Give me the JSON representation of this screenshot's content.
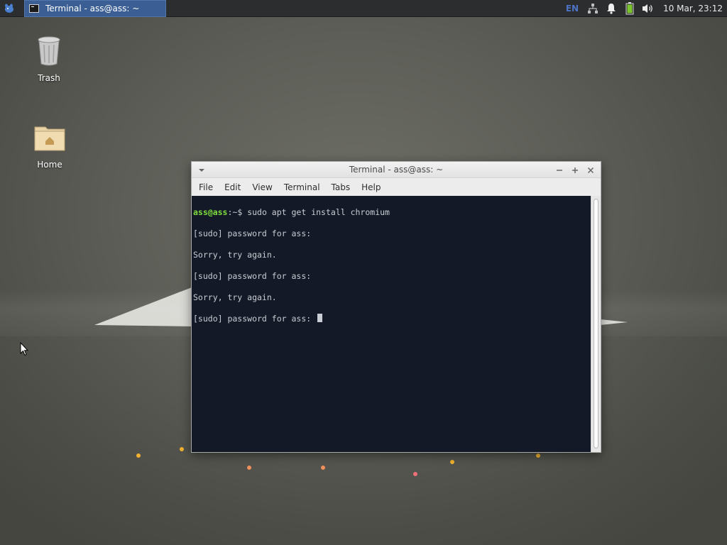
{
  "panel": {
    "app_menu_icon": "xfce-mouse-icon",
    "task_button": {
      "label": "Terminal - ass@ass: ~",
      "icon": "terminal-icon"
    },
    "tray": {
      "keyboard_layout": "EN",
      "network_icon": "network-icon",
      "notifications_icon": "bell-icon",
      "battery_icon": "battery-icon",
      "volume_icon": "speaker-icon",
      "clock": "10 Mar, 23:12"
    }
  },
  "desktop": {
    "icons": [
      {
        "label": "Trash",
        "icon": "trash-icon"
      },
      {
        "label": "Home",
        "icon": "home-folder-icon"
      }
    ]
  },
  "terminal": {
    "title": "Terminal - ass@ass: ~",
    "menus": [
      "File",
      "Edit",
      "View",
      "Terminal",
      "Tabs",
      "Help"
    ],
    "prompt": {
      "user_host": "ass@ass",
      "path": ":~",
      "symbol": "$",
      "command": " sudo apt get install chromium"
    },
    "output": [
      "[sudo] password for ass:",
      "Sorry, try again.",
      "[sudo] password for ass:",
      "Sorry, try again.",
      "[sudo] password for ass: "
    ]
  },
  "colors": {
    "panel_bg": "#2b2d2f",
    "task_active": "#3b5f94",
    "terminal_bg": "#131926",
    "prompt_green": "#7fdc3e",
    "keyboard_layout_blue": "#4d73c4"
  }
}
